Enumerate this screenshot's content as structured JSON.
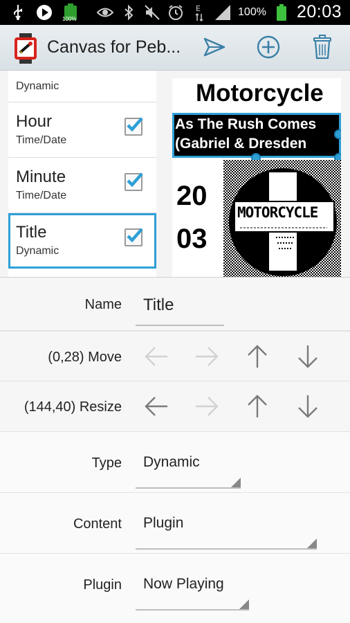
{
  "status_bar": {
    "battery_pct": "100%",
    "time": "20:03",
    "small_battery_label": "100%"
  },
  "action_bar": {
    "title": "Canvas for Peb...",
    "send_icon": "send-icon",
    "add_icon": "add-circle-icon",
    "delete_icon": "trash-icon"
  },
  "element_list": {
    "header": "Dynamic",
    "items": [
      {
        "title": "Hour",
        "subtitle": "Time/Date",
        "checked": true
      },
      {
        "title": "Minute",
        "subtitle": "Time/Date",
        "checked": true
      },
      {
        "title": "Title",
        "subtitle": "Dynamic",
        "checked": true,
        "selected": true
      }
    ]
  },
  "preview": {
    "heading": "Motorcycle",
    "title_line1": "As The Rush Comes",
    "title_line2": "(Gabriel & Dresden",
    "hour": "20",
    "minute": "03",
    "art_text": "MOTORCYCLE"
  },
  "form": {
    "name": {
      "label": "Name",
      "value": "Title"
    },
    "move": {
      "label": "(0,28) Move"
    },
    "resize": {
      "label": "(144,40) Resize"
    },
    "type": {
      "label": "Type",
      "value": "Dynamic"
    },
    "content": {
      "label": "Content",
      "value": "Plugin"
    },
    "plugin": {
      "label": "Plugin",
      "value": "Now Playing"
    }
  },
  "colors": {
    "accent": "#2ea0d6",
    "action_bar": "#dfe6ea"
  }
}
